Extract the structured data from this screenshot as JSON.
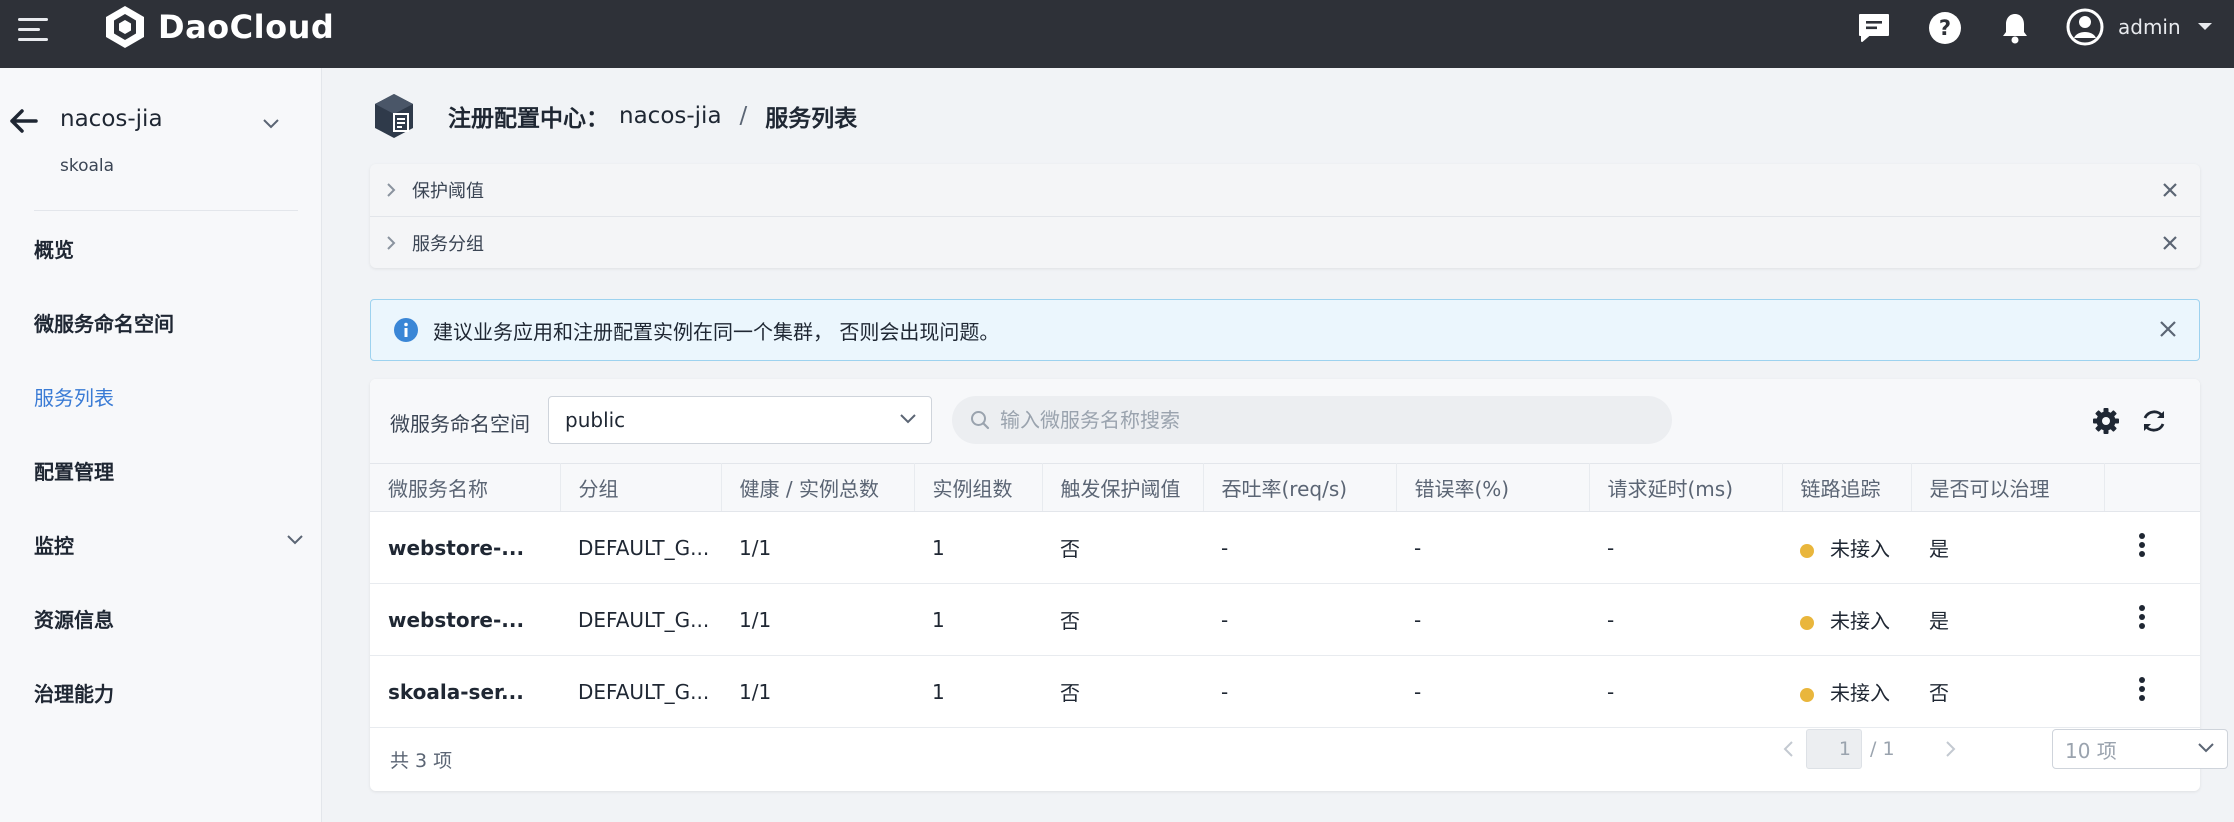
{
  "topbar": {
    "brand": "DaoCloud",
    "user_name": "admin",
    "icons": [
      "message-icon",
      "help-icon",
      "bell-icon",
      "user-avatar-icon"
    ]
  },
  "sidebar": {
    "workspace_name": "nacos-jia",
    "workspace_sub": "skoala",
    "items": [
      {
        "label": "概览"
      },
      {
        "label": "微服务命名空间"
      },
      {
        "label": "服务列表"
      },
      {
        "label": "配置管理"
      },
      {
        "label": "监控"
      },
      {
        "label": "资源信息"
      },
      {
        "label": "治理能力"
      }
    ],
    "active_index": 2
  },
  "header": {
    "crumb_root": "注册配置中心：",
    "crumb_instance": "nacos-jia",
    "crumb_sep": "/",
    "crumb_page": "服务列表"
  },
  "collapse": [
    {
      "title": "保护阈值"
    },
    {
      "title": "服务分组"
    }
  ],
  "alert": {
    "text": "建议业务应用和注册配置实例在同一个集群， 否则会出现问题。"
  },
  "toolbar": {
    "namespace_label": "微服务命名空间",
    "namespace_value": "public",
    "search_placeholder": "输入微服务名称搜索"
  },
  "table": {
    "columns": [
      "微服务名称",
      "分组",
      "健康 / 实例总数",
      "实例组数",
      "触发保护阈值",
      "吞吐率(req/s)",
      "错误率(%)",
      "请求延时(ms)",
      "链路追踪",
      "是否可以治理",
      ""
    ],
    "rows": [
      [
        "webstore-...",
        "DEFAULT_G...",
        "1/1",
        "1",
        "否",
        "-",
        "-",
        "-",
        "未接入",
        "是"
      ],
      [
        "webstore-...",
        "DEFAULT_G...",
        "1/1",
        "1",
        "否",
        "-",
        "-",
        "-",
        "未接入",
        "是"
      ],
      [
        "skoala-ser...",
        "DEFAULT_G...",
        "1/1",
        "1",
        "否",
        "-",
        "-",
        "-",
        "未接入",
        "否"
      ]
    ],
    "trace_dot_color": "#e9b63c"
  },
  "footer": {
    "total": "共 3 项",
    "page_current": "1",
    "page_total": "/ 1",
    "page_size": "10 项"
  }
}
